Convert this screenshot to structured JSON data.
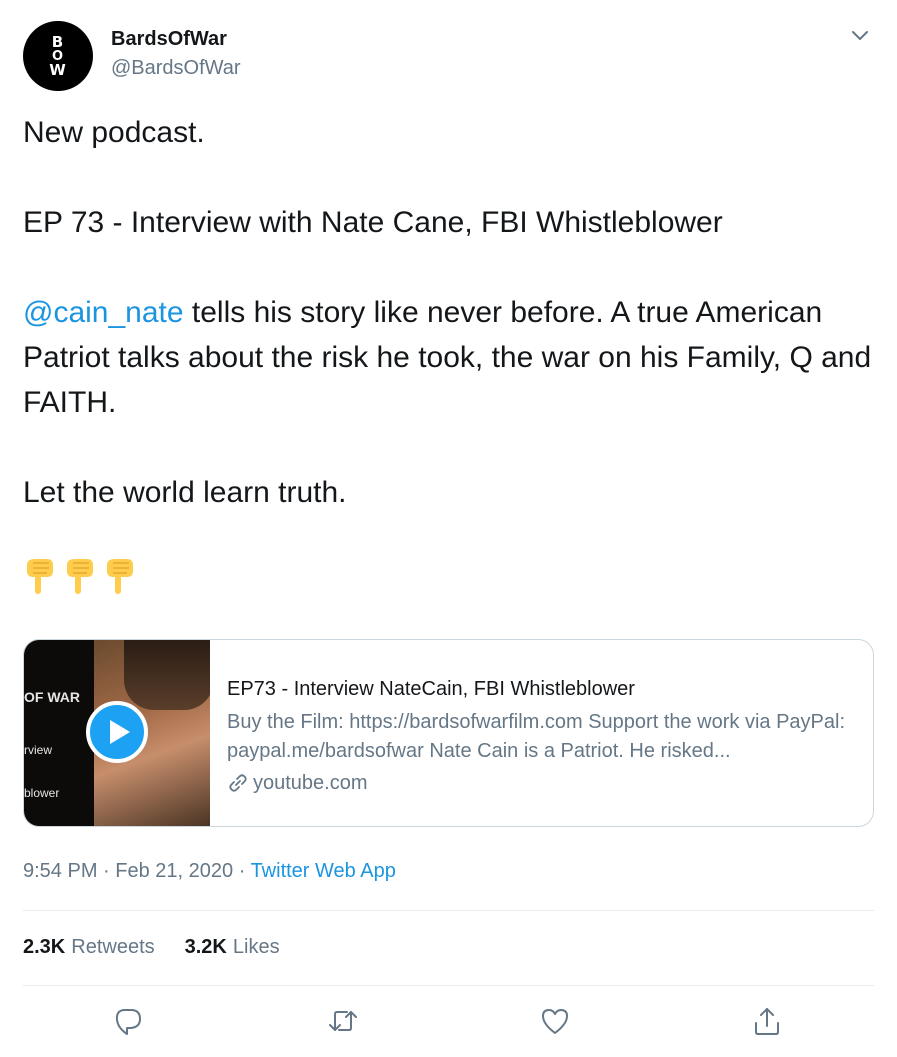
{
  "author": {
    "name": "BardsOfWar",
    "handle": "@BardsOfWar",
    "avatar_letters": [
      "B",
      "O",
      "W"
    ]
  },
  "tweet": {
    "line1": "New podcast.",
    "line2": "EP 73 - Interview with Nate Cane, FBI Whistleblower",
    "mention": "@cain_nate",
    "line3": " tells his story like never before. A true American Patriot talks about the risk he took, the war on his Family, Q and FAITH.",
    "line4": "Let the world learn truth.",
    "emojis": [
      "👇",
      "👇",
      "👇"
    ]
  },
  "card": {
    "thumb_text_1": "OF WAR",
    "thumb_text_2": "rview",
    "thumb_text_3": "blower",
    "title": "EP73 - Interview NateCain, FBI Whistleblower",
    "description": "Buy the Film: https://bardsofwarfilm.com Support the work via PayPal: paypal.me/bardsofwar Nate Cain is a Patriot. He risked...",
    "domain": "youtube.com"
  },
  "meta": {
    "time": "9:54 PM",
    "sep1": " · ",
    "date": "Feb 21, 2020",
    "sep2": " · ",
    "source": "Twitter Web App"
  },
  "stats": {
    "retweets_count": "2.3K",
    "retweets_label": "Retweets",
    "likes_count": "3.2K",
    "likes_label": "Likes"
  },
  "colors": {
    "link": "#1b95e0",
    "secondary_text": "#657786",
    "primary_text": "#14171a",
    "play_button": "#1da1f2",
    "emoji_yellow": "#ffcc4d"
  },
  "icons": {
    "more": "chevron-down-icon",
    "reply": "reply-icon",
    "retweet": "retweet-icon",
    "like": "heart-icon",
    "share": "share-icon",
    "link": "link-icon",
    "play": "play-icon"
  }
}
